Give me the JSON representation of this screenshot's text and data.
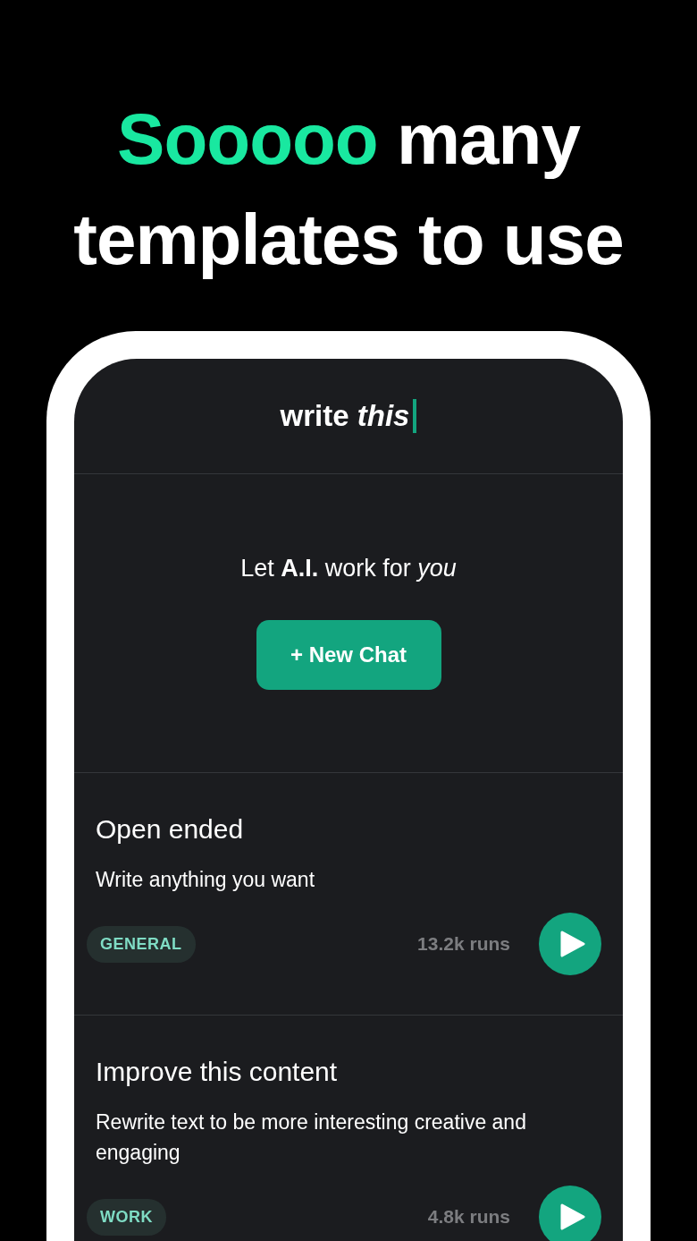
{
  "headline": {
    "accent": "Sooooo",
    "rest": "many templates to use"
  },
  "app": {
    "logo": "write *this*",
    "tagline": "Let **A.I.** work for *you*",
    "new_chat_button": "+ New Chat"
  },
  "templates": [
    {
      "title": "Open ended",
      "description": "Write anything you want",
      "tag": "GENERAL",
      "runs": "13.2k runs"
    },
    {
      "title": "Improve this content",
      "description": "Rewrite text to be more interesting creative and engaging",
      "tag": "WORK",
      "runs": "4.8k runs"
    }
  ]
}
